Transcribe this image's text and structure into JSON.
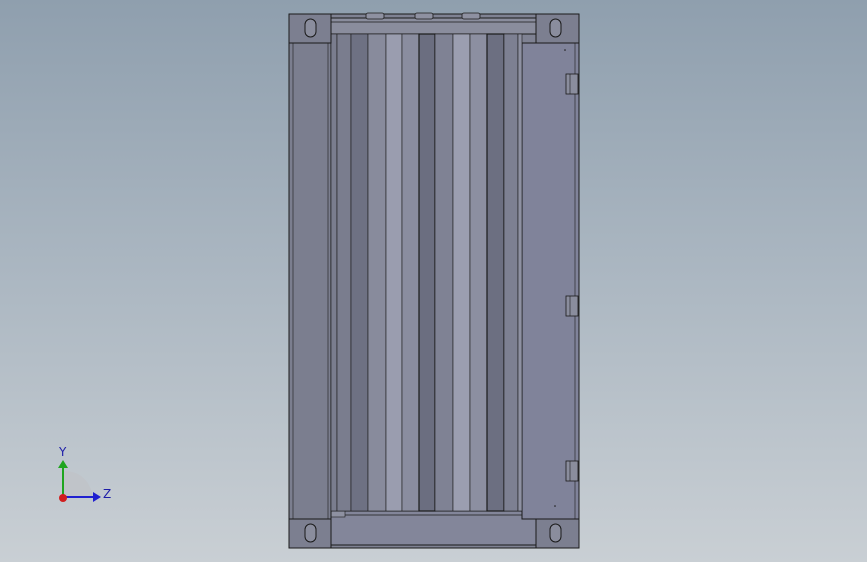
{
  "triad": {
    "y_label": "Y",
    "z_label": "Z"
  },
  "colors": {
    "frame": "#7d8090",
    "corrugation_dark": "#6e7182",
    "corrugation_light": "#9a9daf",
    "outline": "#1a1a1a",
    "axis_y": "#1fa51f",
    "axis_z": "#2020d0",
    "axis_x": "#d01e1e"
  }
}
